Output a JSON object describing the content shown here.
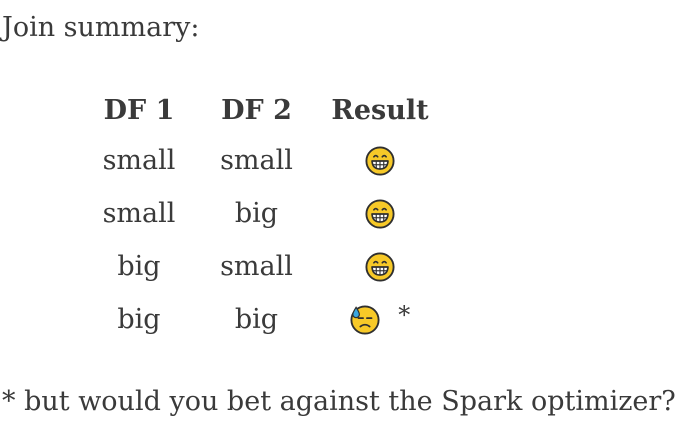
{
  "intro": "Join summary:",
  "table": {
    "headers": [
      "DF 1",
      "DF 2",
      "Result"
    ],
    "rows": [
      {
        "df1": "small",
        "df2": "small",
        "result_icon": "grinning-face-icon",
        "note": ""
      },
      {
        "df1": "small",
        "df2": "big",
        "result_icon": "grinning-face-icon",
        "note": ""
      },
      {
        "df1": "big",
        "df2": "small",
        "result_icon": "grinning-face-icon",
        "note": ""
      },
      {
        "df1": "big",
        "df2": "big",
        "result_icon": "downcast-face-with-sweat-icon",
        "note": "*"
      }
    ]
  },
  "footnote": "* but would you bet against the Spark optimizer?",
  "colors": {
    "text": "#3a3a3a",
    "emoji_face": "#f7c928",
    "emoji_outline": "#2f2f2f",
    "sweat": "#3aa7e0"
  }
}
